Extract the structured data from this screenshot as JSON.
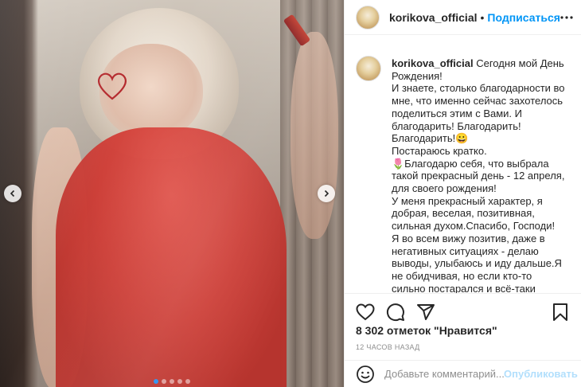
{
  "post": {
    "username": "korikova_official",
    "separator": "•",
    "follow_label": "Подписаться",
    "caption_username": "korikova_official",
    "caption_text": "Сегодня мой День Рождения!\nИ знаете, столько благодарности во мне, что именно сейчас захотелось поделиться этим с Вами. И благодарить! Благодарить! Благодарить!😀\nПостараюсь кратко.\n🌷Благодарю себя, что выбрала такой прекрасный день - 12 апреля, для своего рождения!\nУ меня прекрасный характер, я добрая, веселая, позитивная, сильная духом.Спасибо, Господи!\nЯ во всем вижу позитив, даже в негативных ситуациях - делаю выводы, улыбаюсь и иду дальше.Я не обидчивая, но если кто-то сильно постарался и всё-таки попытался обидеть - проработала, отдала",
    "likes": "8 302 отметок \"Нравится\"",
    "timestamp": "12 часов назад"
  },
  "comment_box": {
    "placeholder": "Добавьте комментарий...",
    "publish_label": "Опубликовать"
  },
  "carousel": {
    "slides": 5,
    "active_index": 0
  },
  "icons": {
    "like": "heart-icon",
    "comment": "comment-icon",
    "share": "paper-plane-icon",
    "save": "bookmark-icon",
    "emoji": "smiley-icon",
    "more": "ellipsis-icon",
    "prev": "chevron-left-icon",
    "next": "chevron-right-icon"
  },
  "colors": {
    "accent": "#0095f6",
    "publish_disabled": "#b2dffc",
    "muted": "#8e8e8e",
    "dot_active": "#3897f0"
  }
}
